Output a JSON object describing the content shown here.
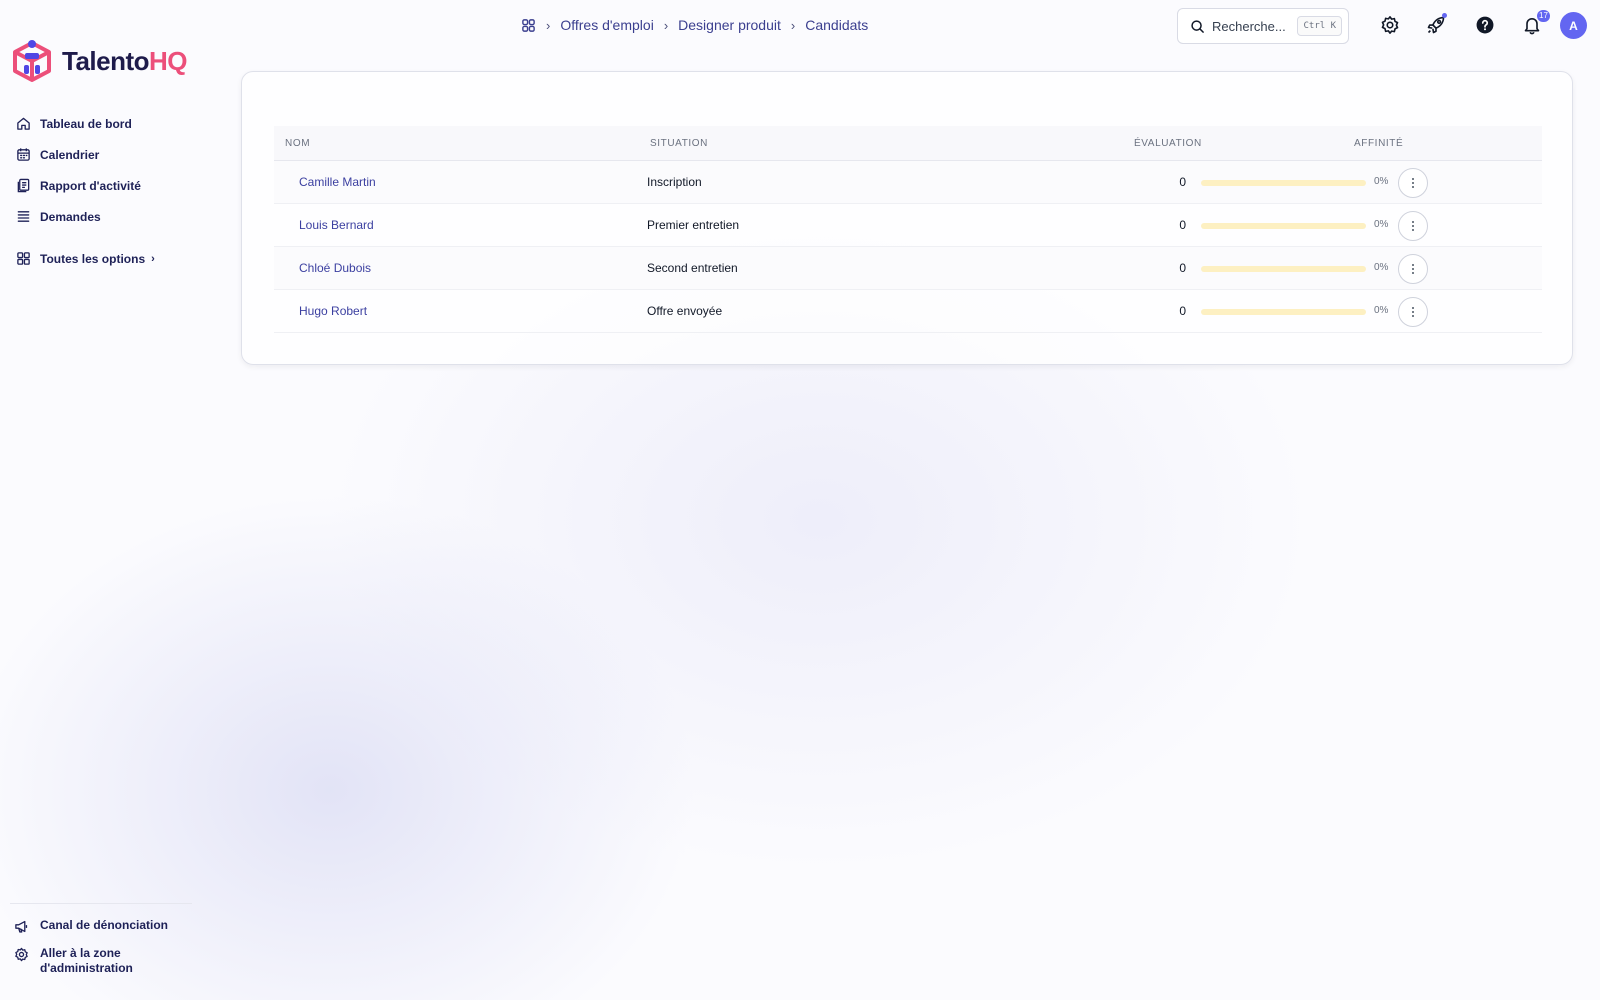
{
  "brand": {
    "name_main": "Talento",
    "name_accent": "HQ"
  },
  "sidebar": {
    "items": [
      {
        "label": "Tableau de bord",
        "icon": "home-icon"
      },
      {
        "label": "Calendrier",
        "icon": "calendar-icon"
      },
      {
        "label": "Rapport d'activité",
        "icon": "report-icon"
      },
      {
        "label": "Demandes",
        "icon": "list-icon"
      }
    ],
    "all_options": {
      "label": "Toutes les options",
      "icon": "grid-icon"
    },
    "bottom": [
      {
        "label": "Canal de dénonciation",
        "icon": "megaphone-icon"
      },
      {
        "label": "Aller à la zone d'administration",
        "icon": "gear-icon"
      }
    ]
  },
  "breadcrumb": {
    "home_icon": "apps-icon",
    "items": [
      "Offres d'emploi",
      "Designer produit",
      "Candidats"
    ]
  },
  "search": {
    "placeholder": "Recherche...",
    "shortcut": "Ctrl K"
  },
  "notifications": {
    "count": "17"
  },
  "user": {
    "initial": "A"
  },
  "colors": {
    "accent": "#6366f1",
    "brand_accent": "#ec4f7a",
    "link": "#3b3fa0",
    "bar": "#f5c542"
  },
  "table": {
    "columns": [
      "NOM",
      "SITUATION",
      "ÉVALUATION",
      "AFFINITÉ"
    ],
    "rows": [
      {
        "name": "Camille Martin",
        "situation": "Inscription",
        "evaluation": "0",
        "affinity_pct": "0%",
        "affinity": 0
      },
      {
        "name": "Louis Bernard",
        "situation": "Premier entretien",
        "evaluation": "0",
        "affinity_pct": "0%",
        "affinity": 0
      },
      {
        "name": "Chloé Dubois",
        "situation": "Second entretien",
        "evaluation": "0",
        "affinity_pct": "0%",
        "affinity": 0
      },
      {
        "name": "Hugo Robert",
        "situation": "Offre envoyée",
        "evaluation": "0",
        "affinity_pct": "0%",
        "affinity": 0
      }
    ]
  }
}
